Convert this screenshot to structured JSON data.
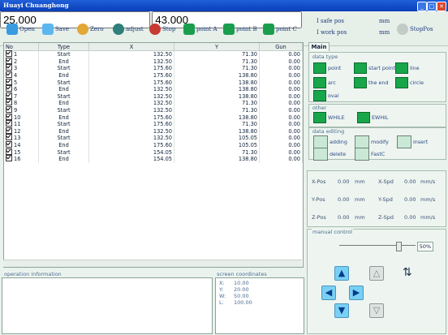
{
  "window": {
    "title": "Huayi Chuanghong",
    "controls": [
      "_",
      "□",
      "✕"
    ]
  },
  "toolbar": {
    "open": "Open",
    "save": "Save",
    "zero": "Zero",
    "adjust": "adjust",
    "stop": "Stop",
    "point_a": "point A",
    "point_b": "point B",
    "point_c": "point C",
    "safe_label": "I safe pos",
    "safe_value": "25.000",
    "work_label": "I work pos",
    "work_value": "43.000",
    "unit": "mm",
    "stoppos": "StopPos"
  },
  "table": {
    "headers": [
      "No",
      "Type",
      "X",
      "Y",
      "Gun"
    ],
    "rows": [
      [
        "1",
        "Start",
        "132.50",
        "71.30",
        "0.00"
      ],
      [
        "2",
        "End",
        "132.50",
        "71.30",
        "0.00"
      ],
      [
        "3",
        "Start",
        "175.60",
        "71.30",
        "0.00"
      ],
      [
        "4",
        "End",
        "175.60",
        "138.80",
        "0.00"
      ],
      [
        "5",
        "Start",
        "175.60",
        "138.80",
        "0.00"
      ],
      [
        "6",
        "End",
        "132.50",
        "138.80",
        "0.00"
      ],
      [
        "7",
        "Start",
        "132.50",
        "138.80",
        "0.00"
      ],
      [
        "8",
        "End",
        "132.50",
        "71.30",
        "0.00"
      ],
      [
        "9",
        "Start",
        "132.50",
        "71.30",
        "0.00"
      ],
      [
        "10",
        "End",
        "175.60",
        "138.80",
        "0.00"
      ],
      [
        "11",
        "Start",
        "175.60",
        "71.30",
        "0.00"
      ],
      [
        "12",
        "End",
        "132.50",
        "138.80",
        "0.00"
      ],
      [
        "13",
        "Start",
        "132.50",
        "105.05",
        "0.00"
      ],
      [
        "14",
        "End",
        "175.60",
        "105.05",
        "0.00"
      ],
      [
        "15",
        "Start",
        "154.05",
        "71.30",
        "0.00"
      ],
      [
        "16",
        "End",
        "154.05",
        "138.80",
        "0.00"
      ]
    ]
  },
  "right": {
    "tab_main": "Main",
    "data_type": "data type",
    "point": "point",
    "start_point": "start point",
    "line": "line",
    "arc": "arc",
    "the_end": "the end",
    "circle": "circle",
    "oval": "oval",
    "other": "other",
    "while": "WHILE",
    "ewhil": "EWHIL",
    "data_editing": "data editing",
    "adding": "adding",
    "modify": "modify",
    "insert": "insert",
    "delete": "delete",
    "modify_sub": "FastC"
  },
  "status": {
    "x_pos": "X-Pos",
    "x_pos_val": "0.00",
    "x_spd": "X-Spd",
    "x_spd_val": "0.00",
    "y_pos": "Y-Pos",
    "y_pos_val": "0.00",
    "y_spd": "Y-Spd",
    "y_spd_val": "0.00",
    "z_pos": "Z-Pos",
    "z_pos_val": "0.00",
    "z_spd": "Z-Spd",
    "z_spd_val": "0.00",
    "mm": "mm",
    "mms": "mm/s"
  },
  "manual": {
    "title": "manual control",
    "percent": "50%",
    "slider_level": 0.8
  },
  "ops": {
    "title": "operation information"
  },
  "screen": {
    "title": "screen coordinates",
    "xl": "X:",
    "x": "10.00",
    "yl": "Y:",
    "y": "20.00",
    "wl": "W:",
    "w": "50.00",
    "ll": "L:",
    "l": "100.00"
  }
}
